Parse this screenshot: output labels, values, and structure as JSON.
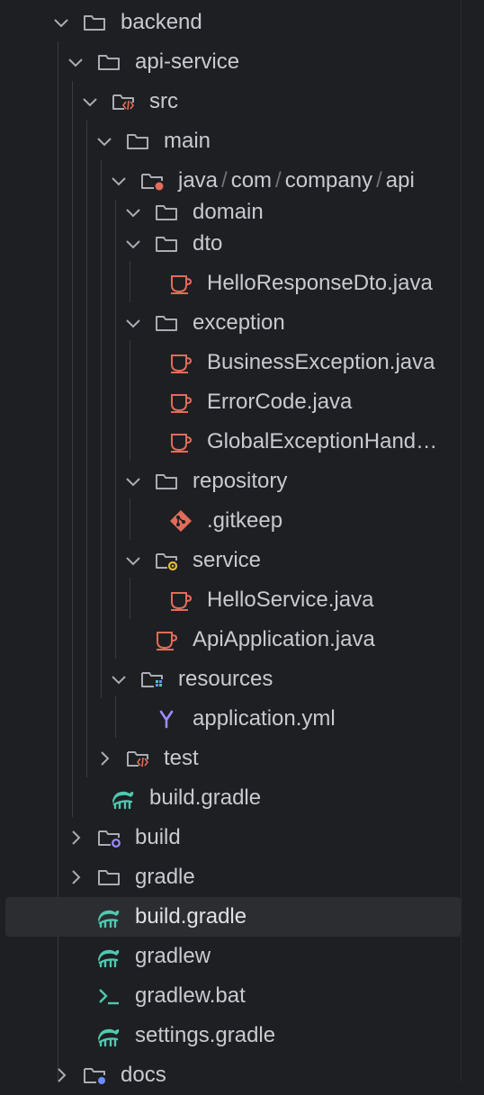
{
  "tree": {
    "items": [
      {
        "label": "backend"
      },
      {
        "label": "api-service"
      },
      {
        "label": "src"
      },
      {
        "label": "main"
      },
      {
        "label_parts": [
          "java",
          "com",
          "company",
          "api"
        ]
      },
      {
        "label": "domain"
      },
      {
        "label": "dto"
      },
      {
        "label": "HelloResponseDto.java"
      },
      {
        "label": "exception"
      },
      {
        "label": "BusinessException.java"
      },
      {
        "label": "ErrorCode.java"
      },
      {
        "label": "GlobalExceptionHand…"
      },
      {
        "label": "repository"
      },
      {
        "label": ".gitkeep"
      },
      {
        "label": "service"
      },
      {
        "label": "HelloService.java"
      },
      {
        "label": "ApiApplication.java"
      },
      {
        "label": "resources"
      },
      {
        "label": "application.yml"
      },
      {
        "label": "test"
      },
      {
        "label": "build.gradle"
      },
      {
        "label": "build"
      },
      {
        "label": "gradle"
      },
      {
        "label": "build.gradle"
      },
      {
        "label": "gradlew"
      },
      {
        "label": "gradlew.bat"
      },
      {
        "label": "settings.gradle"
      },
      {
        "label": "docs"
      }
    ],
    "path_separator": "/"
  },
  "colors": {
    "background": "#1e1f22",
    "selected_row": "#2b2d30",
    "text": "#c7cad1",
    "java_icon": "#e06c5a",
    "gradle_icon": "#4ec9b0",
    "yaml_icon": "#9b8cff",
    "git_icon": "#e06c5a",
    "folder_icon": "#a9adb5"
  },
  "icons": {
    "folder": "folder-icon",
    "source-folder": "source-folder-icon",
    "package-folder": "package-folder-icon",
    "java": "java-file-icon",
    "gradle": "gradle-icon",
    "yaml": "yaml-icon",
    "git": "git-icon",
    "shell": "terminal-icon"
  }
}
